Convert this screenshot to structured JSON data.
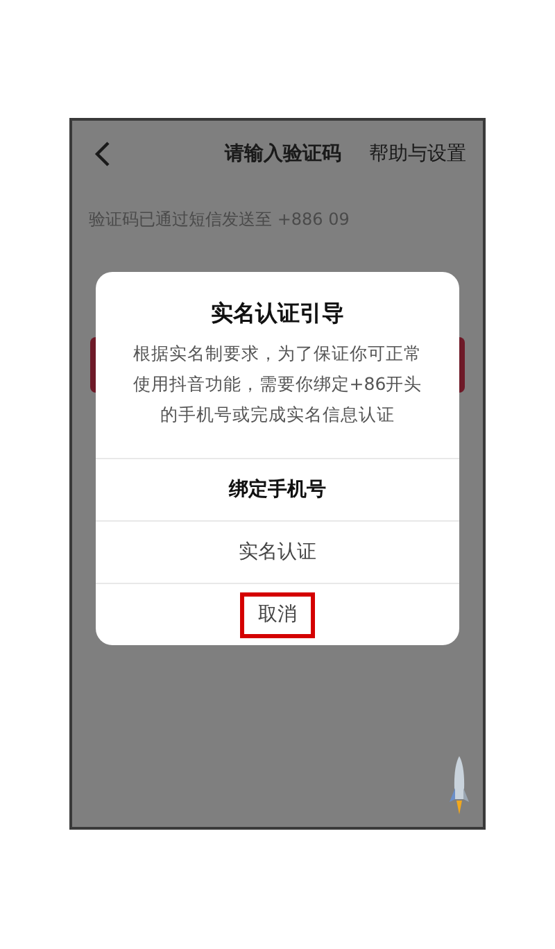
{
  "header": {
    "title": "请输入验证码",
    "action": "帮助与设置"
  },
  "sent_notice": "验证码已通过短信发送至 +886 09",
  "dialog": {
    "title": "实名认证引导",
    "message": "根据实名制要求，为了保证你可正常使用抖音功能，需要你绑定+86开头的手机号或完成实名信息认证",
    "actions": [
      {
        "label": "绑定手机号",
        "kind": "primary",
        "highlighted": false
      },
      {
        "label": "实名认证",
        "kind": "normal",
        "highlighted": false
      },
      {
        "label": "取消",
        "kind": "normal",
        "highlighted": true
      }
    ]
  }
}
